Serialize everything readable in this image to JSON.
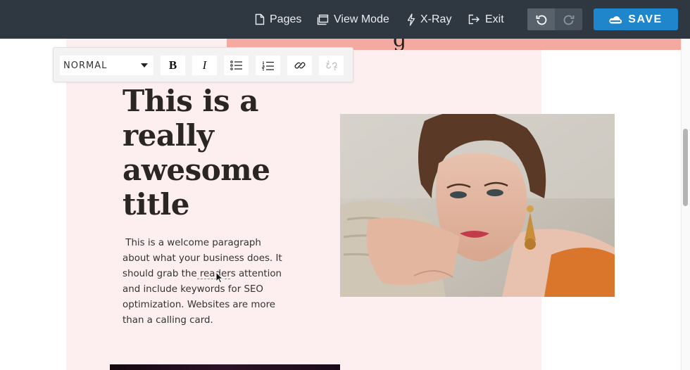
{
  "topbar": {
    "pages_label": "Pages",
    "viewmode_label": "View Mode",
    "xray_label": "X-Ray",
    "exit_label": "Exit",
    "save_label": "SAVE"
  },
  "toolbar": {
    "style_select": "NORMAL",
    "bold_label": "B",
    "italic_label": "I"
  },
  "content": {
    "title": "This is a really awesome title",
    "paragraph": " This is a welcome paragraph about what your business does. It should grab the readers attention and include keywords for SEO optimization. Websites are more than a calling card."
  },
  "colors": {
    "topbar_bg": "#2f3841",
    "save_button": "#1f86cc",
    "panel_bg": "#fdeeef",
    "accent_band": "#f4aaa1"
  },
  "icons": [
    "page-icon",
    "view-mode-icon",
    "lightning-icon",
    "exit-icon",
    "undo-icon",
    "redo-icon",
    "save-cloud-icon",
    "bulleted-list-icon",
    "numbered-list-icon",
    "link-icon",
    "unlink-icon"
  ]
}
